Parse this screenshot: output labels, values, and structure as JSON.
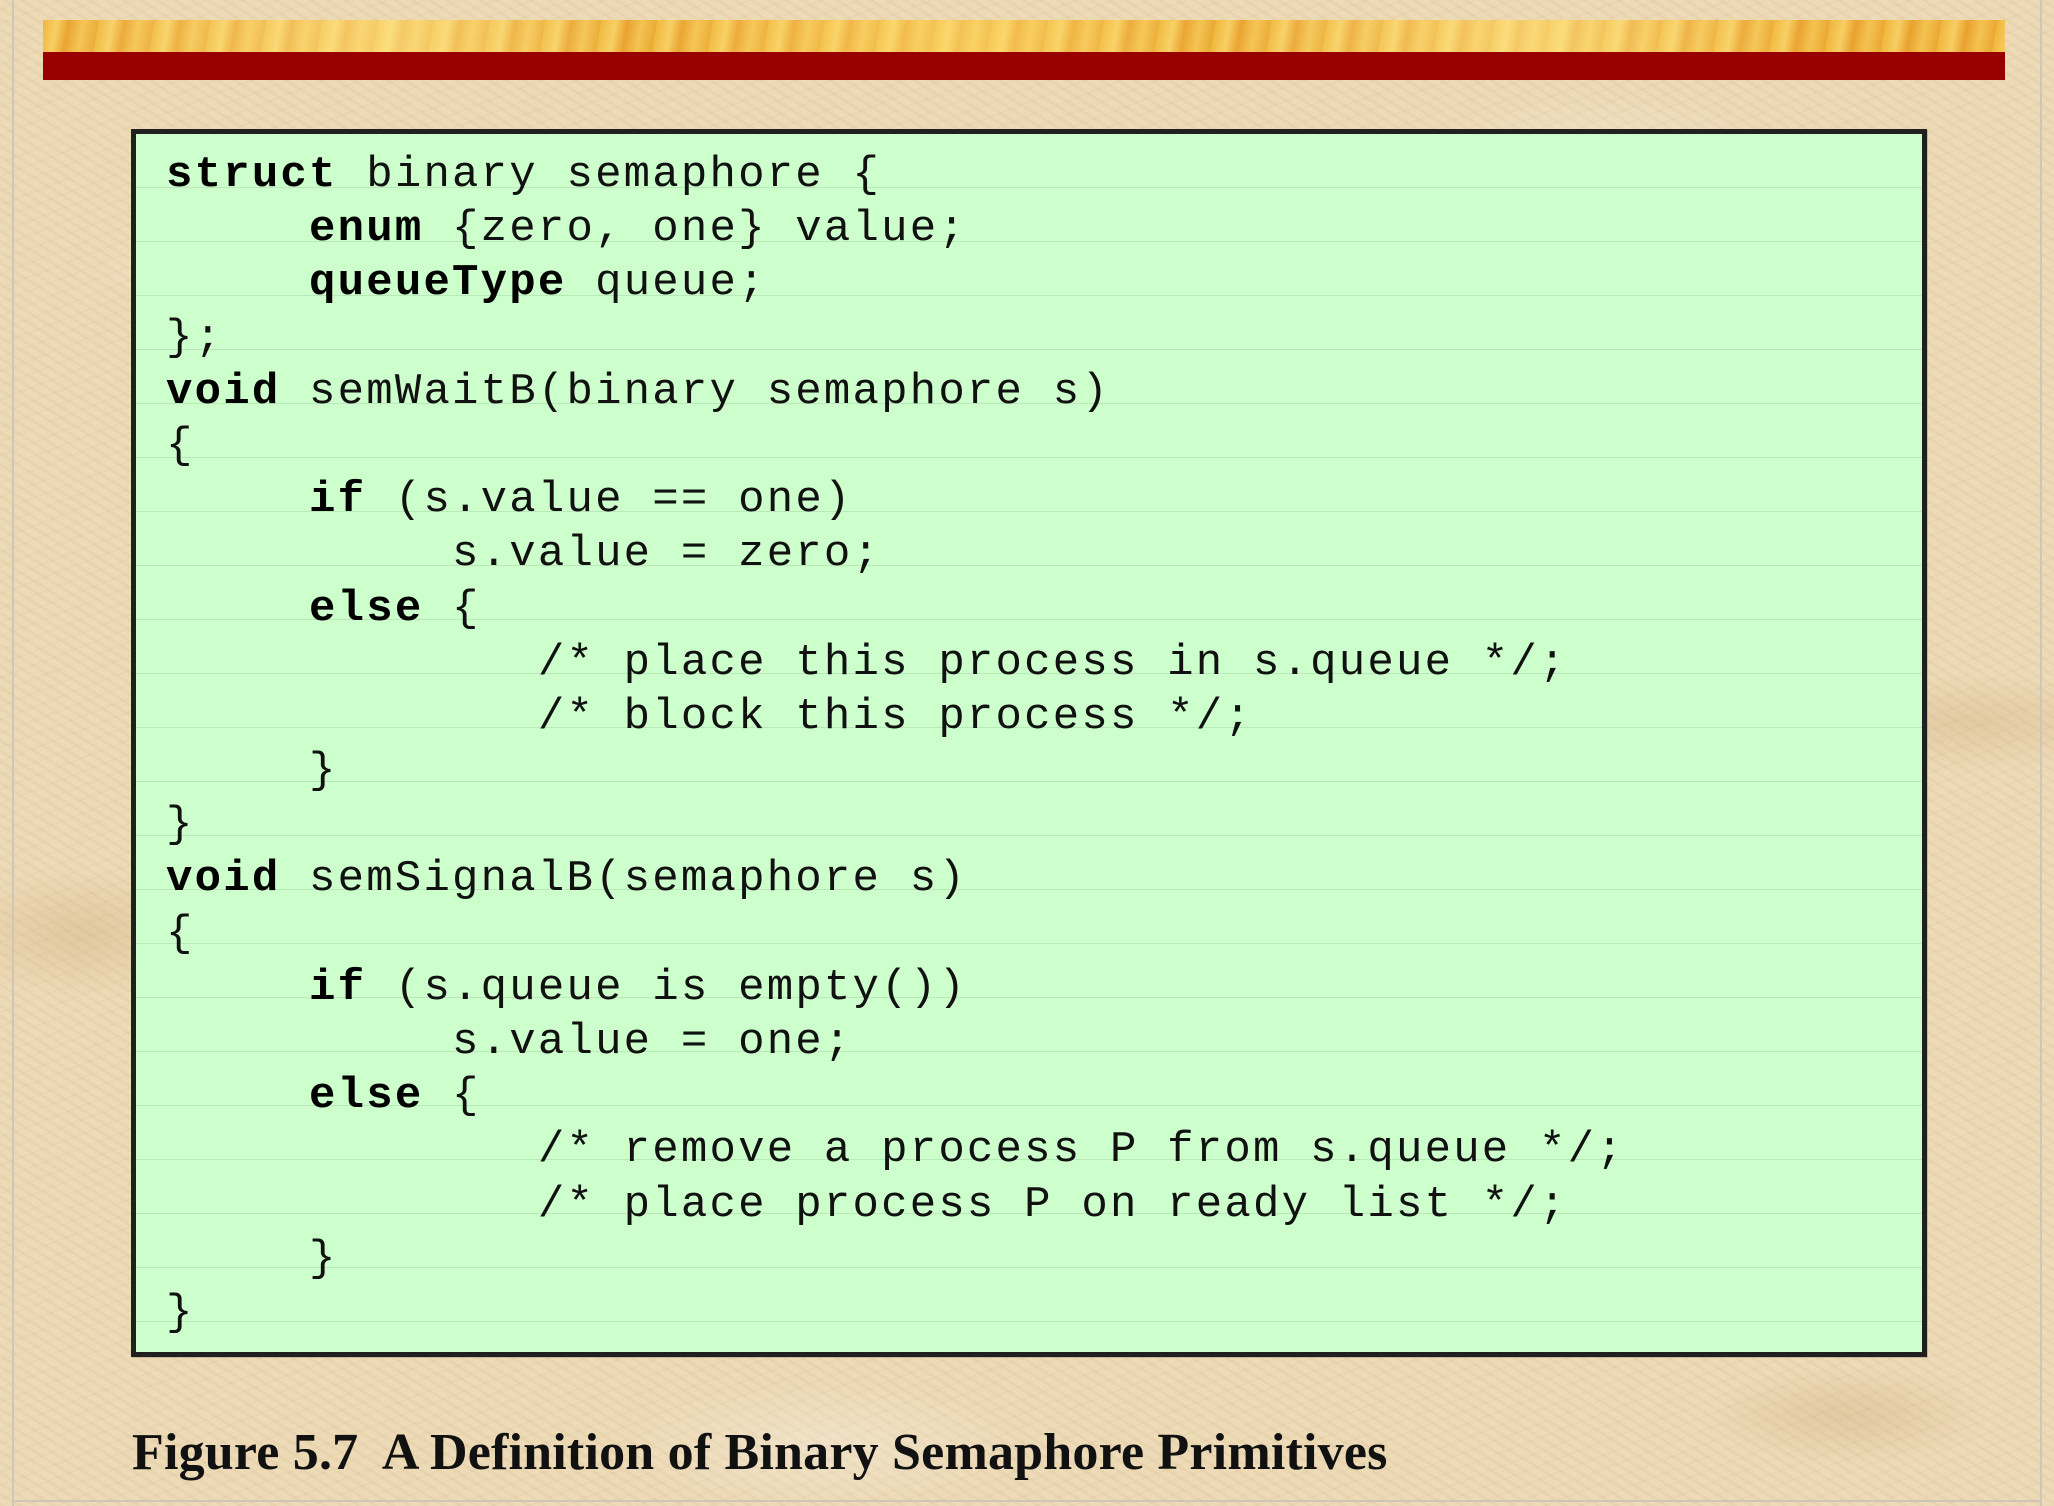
{
  "colors": {
    "banner_gold": "#f0b63c",
    "banner_red": "#990000",
    "code_background": "#ccffcc",
    "code_border": "#202020",
    "page_background": "#ecd9b4"
  },
  "code": {
    "lines": [
      {
        "indent": "",
        "keyword": "struct",
        "text": " binary semaphore {"
      },
      {
        "indent": "     ",
        "keyword": "enum",
        "text": " {zero, one} value;"
      },
      {
        "indent": "     ",
        "keyword": "queueType",
        "text": " queue;"
      },
      {
        "indent": "",
        "keyword": "",
        "text": "};"
      },
      {
        "indent": "",
        "keyword": "void",
        "text": " semWaitB(binary semaphore s)"
      },
      {
        "indent": "",
        "keyword": "",
        "text": "{"
      },
      {
        "indent": "     ",
        "keyword": "if",
        "text": " (s.value == one)"
      },
      {
        "indent": "          ",
        "keyword": "",
        "text": "s.value = zero;"
      },
      {
        "indent": "     ",
        "keyword": "else",
        "text": " {"
      },
      {
        "indent": "             ",
        "keyword": "",
        "text": "/* place this process in s.queue */;"
      },
      {
        "indent": "             ",
        "keyword": "",
        "text": "/* block this process */;"
      },
      {
        "indent": "     ",
        "keyword": "",
        "text": "}"
      },
      {
        "indent": "",
        "keyword": "",
        "text": "}"
      },
      {
        "indent": "",
        "keyword": "void",
        "text": " semSignalB(semaphore s)"
      },
      {
        "indent": "",
        "keyword": "",
        "text": "{"
      },
      {
        "indent": "     ",
        "keyword": "if",
        "text": " (s.queue is empty())"
      },
      {
        "indent": "          ",
        "keyword": "",
        "text": "s.value = one;"
      },
      {
        "indent": "     ",
        "keyword": "else",
        "text": " {"
      },
      {
        "indent": "             ",
        "keyword": "",
        "text": "/* remove a process P from s.queue */;"
      },
      {
        "indent": "             ",
        "keyword": "",
        "text": "/* place process P on ready list */;"
      },
      {
        "indent": "     ",
        "keyword": "",
        "text": "}"
      },
      {
        "indent": "",
        "keyword": "",
        "text": "}"
      }
    ]
  },
  "caption": "Figure 5.7  A Definition of Binary Semaphore Primitives"
}
